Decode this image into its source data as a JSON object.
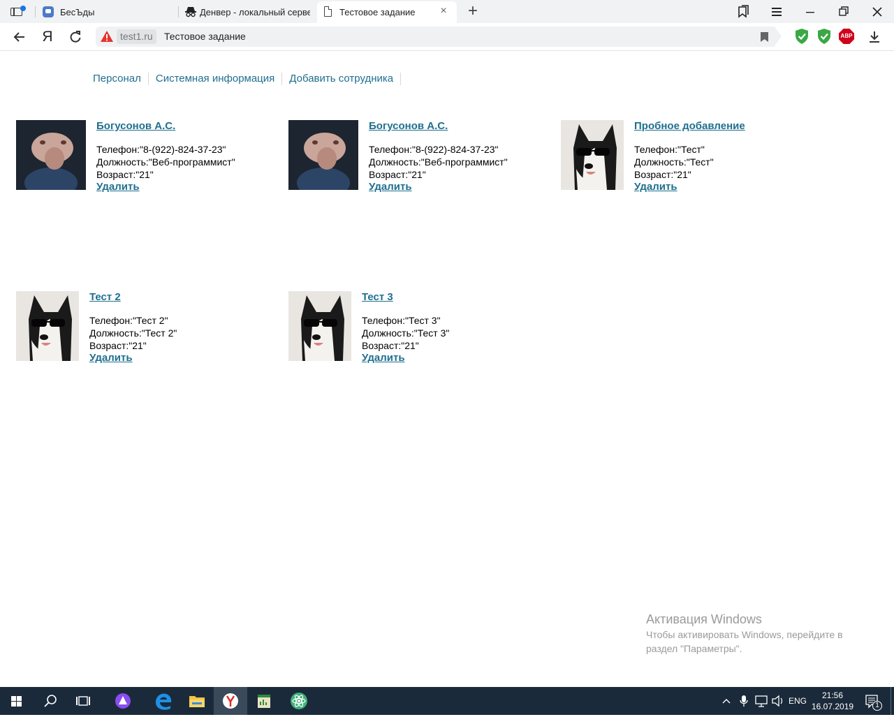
{
  "browser": {
    "tabs": [
      {
        "title": "БесЪды",
        "icon": "chat-icon"
      },
      {
        "title": "Денвер - локальный серве",
        "icon": "denwer-icon"
      },
      {
        "title": "Тестовое задание",
        "icon": "document-icon",
        "active": true
      }
    ],
    "address": {
      "domain": "test1.ru",
      "page_title": "Тестовое задание"
    },
    "extensions": [
      "shield-check-icon",
      "shield-check-icon",
      "adblock-icon"
    ],
    "abp_label": "ABP"
  },
  "page": {
    "menu": [
      {
        "label": "Персонал"
      },
      {
        "label": "Системная информация"
      },
      {
        "label": "Добавить сотрудника"
      }
    ],
    "employees": [
      {
        "name": "Богусонов А.С.",
        "phone": "Телефон:\"8-(922)-824-37-23\"",
        "position": "Должность:\"Веб-программист\"",
        "age": "Возраст:\"21\"",
        "delete": "Удалить",
        "photo": "portrait-photo"
      },
      {
        "name": "Богусонов А.С.",
        "phone": "Телефон:\"8-(922)-824-37-23\"",
        "position": "Должность:\"Веб-программист\"",
        "age": "Возраст:\"21\"",
        "delete": "Удалить",
        "photo": "portrait-photo"
      },
      {
        "name": "Пробное добавление",
        "phone": "Телефон:\"Тест\"",
        "position": "Должность:\"Тест\"",
        "age": "Возраст:\"21\"",
        "delete": "Удалить",
        "photo": "husky-photo"
      },
      {
        "name": "Тест 2",
        "phone": "Телефон:\"Тест 2\"",
        "position": "Должность:\"Тест 2\"",
        "age": "Возраст:\"21\"",
        "delete": "Удалить",
        "photo": "husky-photo"
      },
      {
        "name": "Тест 3",
        "phone": "Телефон:\"Тест 3\"",
        "position": "Должность:\"Тест 3\"",
        "age": "Возраст:\"21\"",
        "delete": "Удалить",
        "photo": "husky-photo"
      }
    ]
  },
  "watermark": {
    "title": "Активация Windows",
    "subtitle": "Чтобы активировать Windows, перейдите в раздел \"Параметры\"."
  },
  "taskbar": {
    "language": "ENG",
    "time": "21:56",
    "date": "16.07.2019",
    "notifications": "1"
  },
  "colors": {
    "link": "#1f6f8f",
    "taskbar": "#1b2a3a",
    "accent": "#1a73e8"
  }
}
